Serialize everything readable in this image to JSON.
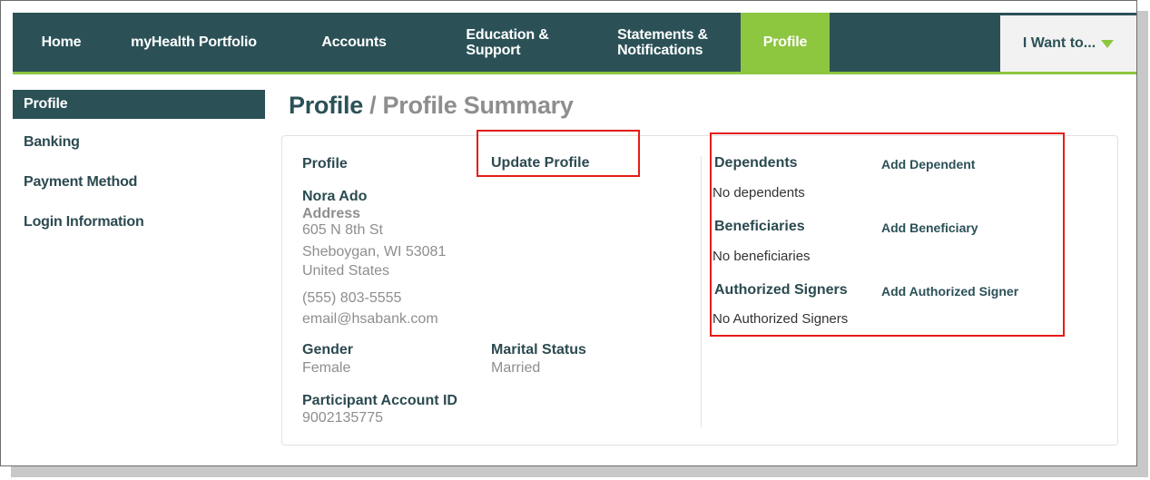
{
  "nav": {
    "items": [
      {
        "label": "Home"
      },
      {
        "label": "myHealth Portfolio"
      },
      {
        "label": "Accounts"
      },
      {
        "label": "Education &\nSupport"
      },
      {
        "label": "Statements &\nNotifications"
      },
      {
        "label": "Profile",
        "active": true
      }
    ],
    "want_label": "I Want to...",
    "colors": {
      "bar": "#2b5157",
      "accent": "#8dc63f"
    }
  },
  "sidebar": {
    "items": [
      {
        "label": "Profile"
      },
      {
        "label": "Banking"
      },
      {
        "label": "Payment Method"
      },
      {
        "label": "Login Information"
      }
    ]
  },
  "page": {
    "title": "Profile",
    "separator": " / ",
    "subtitle": "Profile Summary"
  },
  "profile": {
    "heading": "Profile",
    "update_link": "Update Profile",
    "name": "Nora Ado",
    "address_label": "Address",
    "address_line1": "605 N 8th St",
    "address_line2": "Sheboygan, WI 53081",
    "address_line3": "United States",
    "phone": "(555) 803-5555",
    "email": "email@hsabank.com",
    "gender_label": "Gender",
    "gender_value": "Female",
    "marital_label": "Marital Status",
    "marital_value": "Married",
    "account_id_label": "Participant Account ID",
    "account_id_value": "9002135775"
  },
  "related": {
    "dependents_label": "Dependents",
    "add_dependent": "Add Dependent",
    "dependents_empty": "No dependents",
    "beneficiaries_label": "Beneficiaries",
    "add_beneficiary": "Add Beneficiary",
    "beneficiaries_empty": "No beneficiaries",
    "signers_label": "Authorized Signers",
    "add_signer": "Add Authorized Signer",
    "signers_empty": "No Authorized Signers"
  },
  "highlight_color": "#e41b17"
}
